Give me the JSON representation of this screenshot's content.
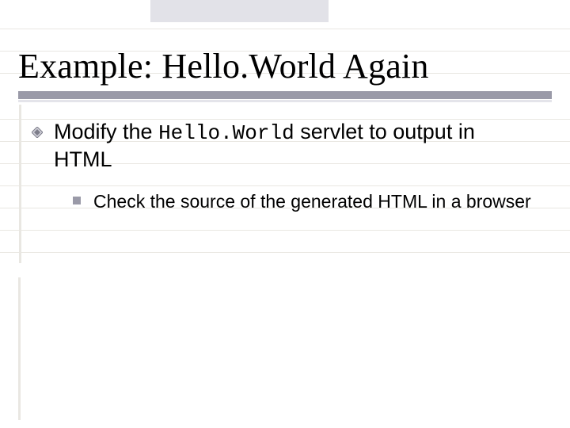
{
  "slide": {
    "title": "Example: Hello.World Again",
    "bullet1": {
      "pre": "Modify the ",
      "code": "Hello.World",
      "post": " servlet to output in HTML"
    },
    "bullet2": "Check the source of the generated HTML in a browser"
  }
}
